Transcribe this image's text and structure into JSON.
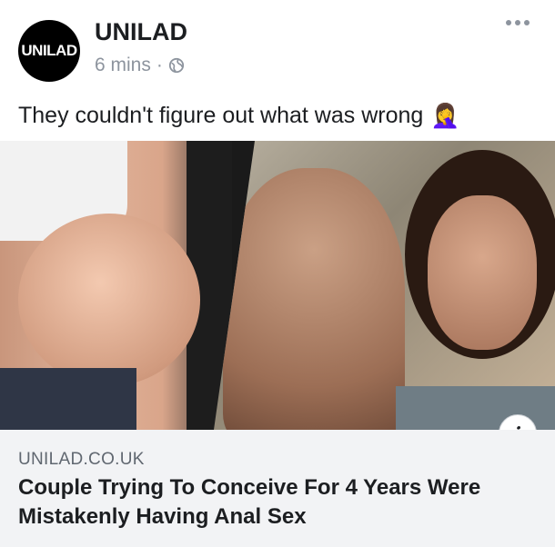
{
  "post": {
    "avatar_text": "UNILAD",
    "page_name": "UNILAD",
    "time": "6 mins",
    "separator": "·",
    "privacy_icon": "globe-icon",
    "more_icon": "more-options-icon",
    "text": "They couldn't figure out what was wrong",
    "emoji": "🤦‍♀️"
  },
  "image": {
    "left_description_icon": "pregnant-belly-photo",
    "right_description_icon": "couple-in-bed-photo"
  },
  "link_preview": {
    "info_label": "i",
    "domain": "UNILAD.CO.UK",
    "headline": "Couple Trying To Conceive For 4 Years Were Mistakenly Having Anal Sex"
  }
}
